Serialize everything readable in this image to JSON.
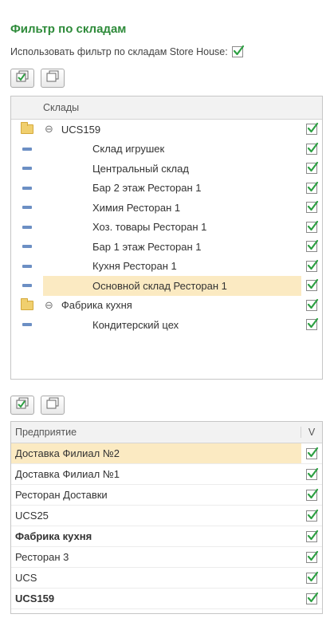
{
  "title": "Фильтр по складам",
  "filter_option": {
    "label": "Использовать фильтр по складам Store House:",
    "checked": true
  },
  "warehouses": {
    "toolbar": {
      "check_all_icon": "check-all-icon",
      "uncheck_all_icon": "uncheck-all-icon"
    },
    "header": "Склады",
    "rows": [
      {
        "label": "UCS159",
        "type": "group",
        "checked": true
      },
      {
        "label": "Склад игрушек",
        "type": "item",
        "checked": true
      },
      {
        "label": "Центральный склад",
        "type": "item",
        "checked": true
      },
      {
        "label": "Бар 2 этаж Ресторан 1",
        "type": "item",
        "checked": true
      },
      {
        "label": "Химия Ресторан 1",
        "type": "item",
        "checked": true
      },
      {
        "label": "Хоз. товары Ресторан 1",
        "type": "item",
        "checked": true
      },
      {
        "label": "Бар 1 этаж Ресторан 1",
        "type": "item",
        "checked": true
      },
      {
        "label": "Кухня Ресторан 1",
        "type": "item",
        "checked": true
      },
      {
        "label": "Основной склад Ресторан 1",
        "type": "item",
        "checked": true,
        "selected": true
      },
      {
        "label": "Фабрика кухня",
        "type": "group",
        "checked": true
      },
      {
        "label": "Кондитерский цех",
        "type": "item",
        "checked": true
      }
    ]
  },
  "enterprises": {
    "header_name": "Предприятие",
    "header_v": "V",
    "rows": [
      {
        "label": "Доставка Филиал №2",
        "checked": true,
        "selected": true
      },
      {
        "label": "Доставка Филиал №1",
        "checked": true
      },
      {
        "label": "Ресторан Доставки",
        "checked": true
      },
      {
        "label": "UCS25",
        "checked": true
      },
      {
        "label": "Фабрика кухня",
        "checked": true,
        "bold": true
      },
      {
        "label": "Ресторан 3",
        "checked": true
      },
      {
        "label": "UCS",
        "checked": true
      },
      {
        "label": "UCS159",
        "checked": true,
        "bold": true
      }
    ]
  },
  "colors": {
    "accent_green": "#2e8b3a",
    "selection": "#fbeac2",
    "check_green": "#2ea043"
  }
}
